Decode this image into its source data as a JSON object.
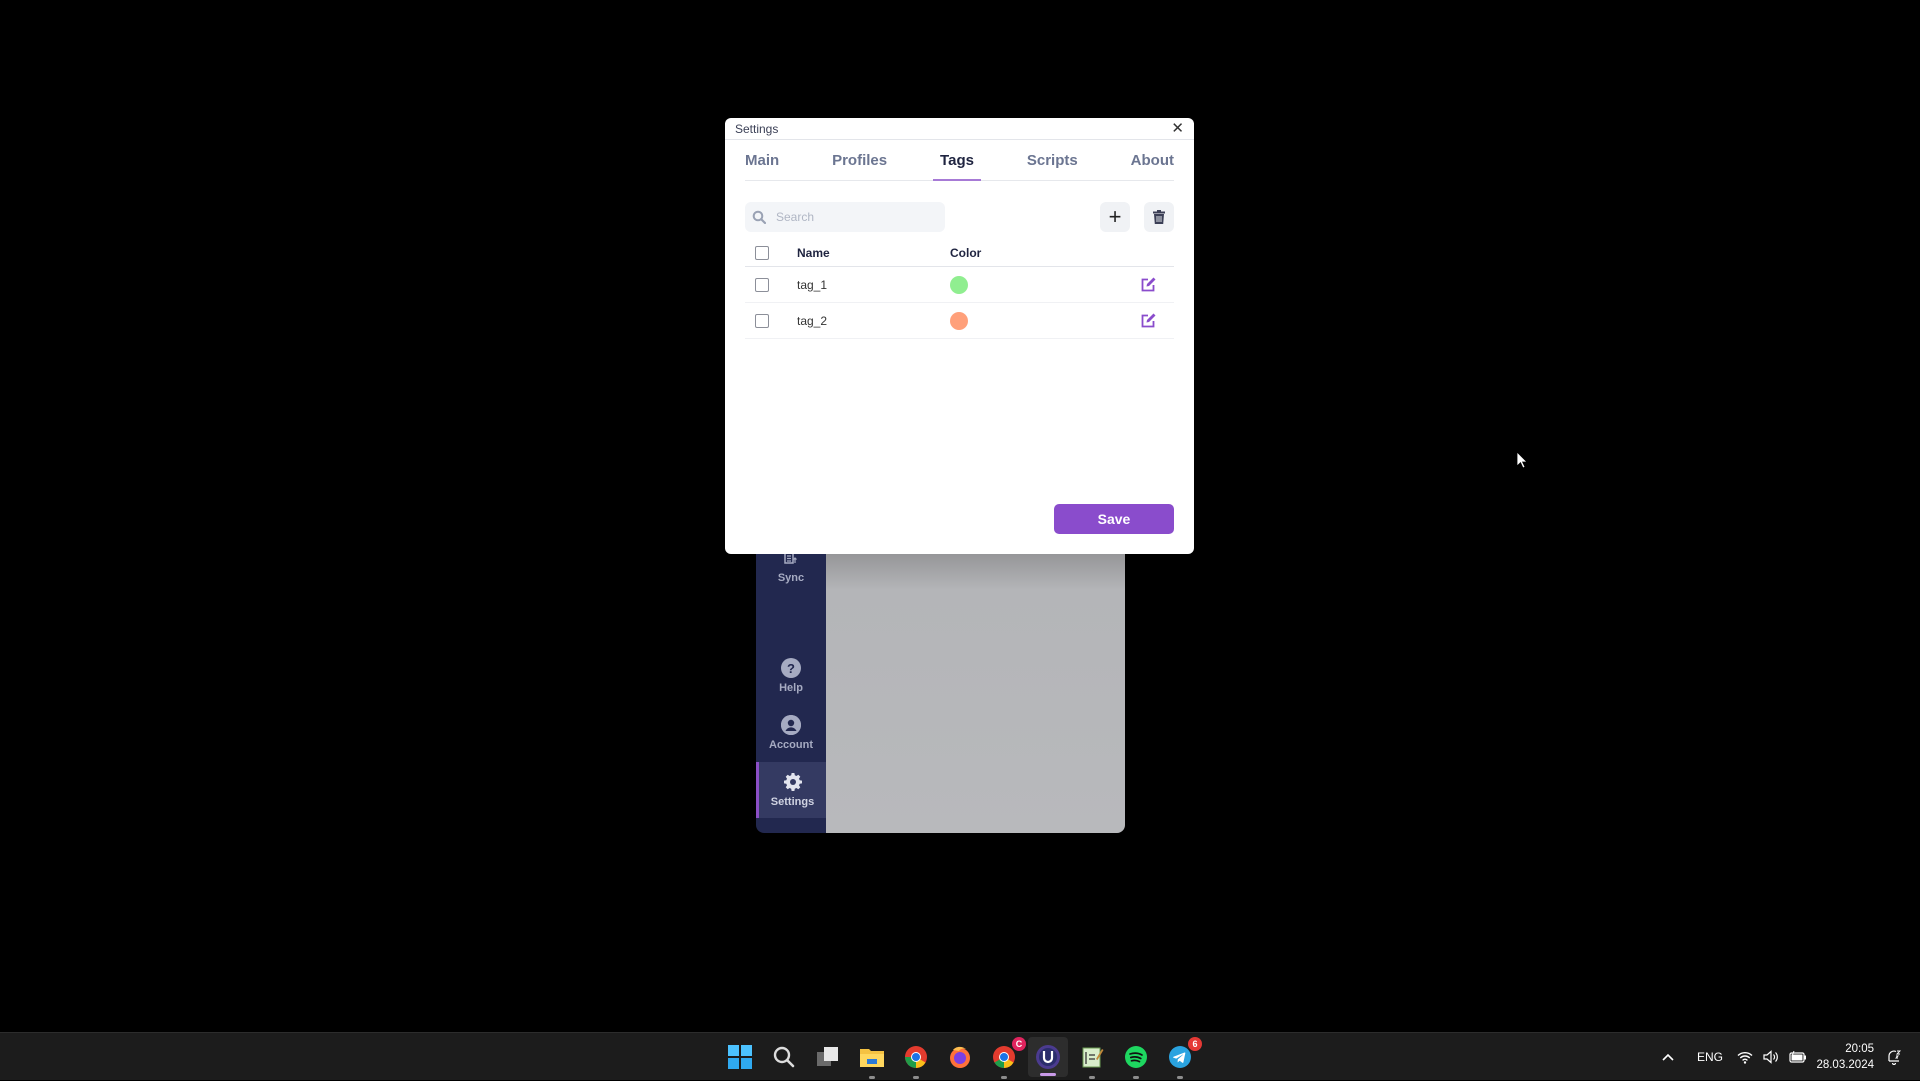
{
  "background_app": {
    "sidebar": {
      "items": [
        {
          "label": "Sync",
          "icon": "sync-icon"
        },
        {
          "label": "Help",
          "icon": "help-icon"
        },
        {
          "label": "Account",
          "icon": "account-icon"
        },
        {
          "label": "Settings",
          "icon": "gear-icon",
          "active": true
        }
      ]
    }
  },
  "dialog": {
    "title": "Settings",
    "close_glyph": "✕",
    "tabs": [
      {
        "label": "Main"
      },
      {
        "label": "Profiles"
      },
      {
        "label": "Tags",
        "active": true
      },
      {
        "label": "Scripts"
      },
      {
        "label": "About"
      }
    ],
    "search": {
      "placeholder": "Search",
      "value": ""
    },
    "add_glyph": "+",
    "table": {
      "columns": [
        "Name",
        "Color"
      ],
      "rows": [
        {
          "name": "tag_1",
          "color": "#90ee90"
        },
        {
          "name": "tag_2",
          "color": "#ffa07a"
        }
      ]
    },
    "save_label": "Save"
  },
  "taskbar": {
    "apps": [
      {
        "name": "start"
      },
      {
        "name": "search"
      },
      {
        "name": "task-view"
      },
      {
        "name": "file-explorer",
        "running": true
      },
      {
        "name": "chrome",
        "running": true
      },
      {
        "name": "firefox"
      },
      {
        "name": "chrome-profile",
        "running": true,
        "badge": "C"
      },
      {
        "name": "app-u",
        "running": true,
        "active": true
      },
      {
        "name": "notepad",
        "running": true
      },
      {
        "name": "spotify",
        "running": true
      },
      {
        "name": "telegram",
        "running": true,
        "badge": "6"
      }
    ],
    "tray": {
      "chevron": "^",
      "language": "ENG",
      "time": "20:05",
      "date": "28.03.2024"
    }
  },
  "colors": {
    "accent": "#8a4ccc",
    "sidebar_bg": "#22284f"
  }
}
